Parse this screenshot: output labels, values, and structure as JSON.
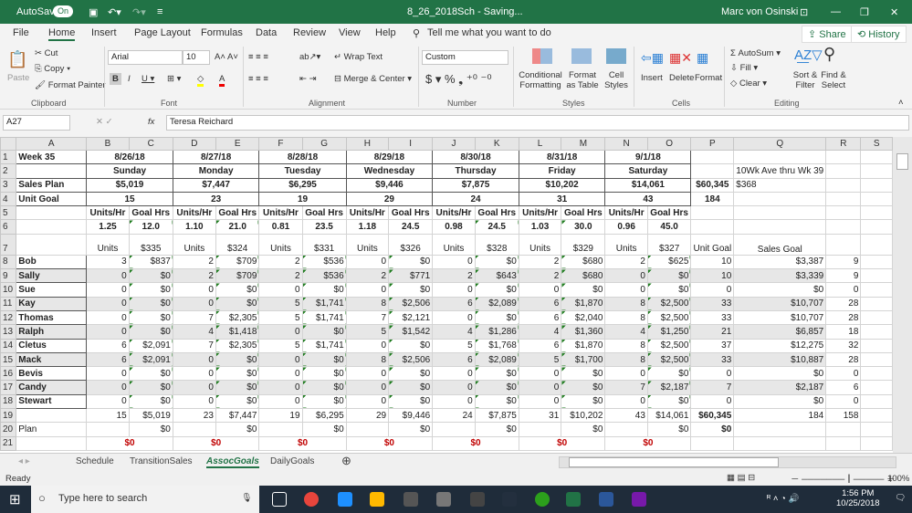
{
  "titlebar": {
    "autosave": "AutoSave",
    "toggle": "On",
    "doc_title": "8_26_2018Sch - Saving...",
    "user": "Marc von Osinski"
  },
  "menu": {
    "tabs": [
      "File",
      "Home",
      "Insert",
      "Page Layout",
      "Formulas",
      "Data",
      "Review",
      "View",
      "Help"
    ],
    "tell_me": "Tell me what you want to do",
    "share": "Share",
    "history": "History"
  },
  "ribbon": {
    "clipboard": {
      "paste": "Paste",
      "cut": "Cut",
      "copy": "Copy",
      "format_painter": "Format Painter",
      "label": "Clipboard"
    },
    "font": {
      "name": "Arial",
      "size": "10",
      "label": "Font"
    },
    "alignment": {
      "wrap": "Wrap Text",
      "merge": "Merge & Center",
      "label": "Alignment"
    },
    "number": {
      "format": "Custom",
      "label": "Number"
    },
    "styles": {
      "conditional": "Conditional Formatting",
      "format_table": "Format as Table",
      "cell_styles": "Cell Styles",
      "label": "Styles"
    },
    "cells": {
      "insert": "Insert",
      "delete": "Delete",
      "format": "Format",
      "label": "Cells"
    },
    "editing": {
      "autosum": "AutoSum",
      "fill": "Fill",
      "clear": "Clear",
      "sort": "Sort & Filter",
      "find": "Find & Select",
      "label": "Editing"
    }
  },
  "formula_bar": {
    "name_box": "A27",
    "fx": "fx",
    "value": "Teresa Reichard"
  },
  "columns": [
    "A",
    "B",
    "C",
    "D",
    "E",
    "F",
    "G",
    "H",
    "I",
    "J",
    "K",
    "L",
    "M",
    "N",
    "O",
    "P",
    "Q",
    "R",
    "S"
  ],
  "rows": [
    [
      "Week 35",
      "8/26/18",
      "",
      "8/27/18",
      "",
      "8/28/18",
      "",
      "8/29/18",
      "",
      "8/30/18",
      "",
      "8/31/18",
      "",
      "9/1/18",
      "",
      "",
      "",
      "",
      ""
    ],
    [
      "",
      "Sunday",
      "",
      "Monday",
      "",
      "Tuesday",
      "",
      "Wednesday",
      "",
      "Thursday",
      "",
      "Friday",
      "",
      "Saturday",
      "",
      "",
      "10Wk Ave thru Wk 39",
      "",
      ""
    ],
    [
      "Sales Plan",
      "$5,019",
      "",
      "$7,447",
      "",
      "$6,295",
      "",
      "$9,446",
      "",
      "$7,875",
      "",
      "$10,202",
      "",
      "$14,061",
      "",
      "$60,345",
      "$368",
      "",
      ""
    ],
    [
      "Unit Goal",
      "15",
      "",
      "23",
      "",
      "19",
      "",
      "29",
      "",
      "24",
      "",
      "31",
      "",
      "43",
      "",
      "184",
      "",
      "",
      ""
    ],
    [
      "",
      "Units/Hr",
      "Goal Hrs",
      "Units/Hr",
      "Goal Hrs",
      "Units/Hr",
      "Goal Hrs",
      "Units/Hr",
      "Goal Hrs",
      "Units/Hr",
      "Goal Hrs",
      "Units/Hr",
      "Goal Hrs",
      "Units/Hr",
      "Goal Hrs",
      "",
      "",
      "",
      ""
    ],
    [
      "",
      "1.25",
      "12.0",
      "1.10",
      "21.0",
      "0.81",
      "23.5",
      "1.18",
      "24.5",
      "0.98",
      "24.5",
      "1.03",
      "30.0",
      "0.96",
      "45.0",
      "",
      "",
      "",
      ""
    ],
    [
      "",
      "Units",
      "$335",
      "Units",
      "$324",
      "Units",
      "$331",
      "Units",
      "$326",
      "Units",
      "$328",
      "Units",
      "$329",
      "Units",
      "$327",
      "Unit Goal",
      "Sales Goal",
      "",
      ""
    ],
    [
      "Bob",
      "3",
      "$837",
      "2",
      "$709",
      "2",
      "$536",
      "0",
      "$0",
      "0",
      "$0",
      "2",
      "$680",
      "2",
      "$625",
      "10",
      "$3,387",
      "9",
      ""
    ],
    [
      "Sally",
      "0",
      "$0",
      "2",
      "$709",
      "2",
      "$536",
      "2",
      "$771",
      "2",
      "$643",
      "2",
      "$680",
      "0",
      "$0",
      "10",
      "$3,339",
      "9",
      ""
    ],
    [
      "Sue",
      "0",
      "$0",
      "0",
      "$0",
      "0",
      "$0",
      "0",
      "$0",
      "0",
      "$0",
      "0",
      "$0",
      "0",
      "$0",
      "0",
      "$0",
      "0",
      ""
    ],
    [
      "Kay",
      "0",
      "$0",
      "0",
      "$0",
      "5",
      "$1,741",
      "8",
      "$2,506",
      "6",
      "$2,089",
      "6",
      "$1,870",
      "8",
      "$2,500",
      "33",
      "$10,707",
      "28",
      ""
    ],
    [
      "Thomas",
      "0",
      "$0",
      "7",
      "$2,305",
      "5",
      "$1,741",
      "7",
      "$2,121",
      "0",
      "$0",
      "6",
      "$2,040",
      "8",
      "$2,500",
      "33",
      "$10,707",
      "28",
      ""
    ],
    [
      "Ralph",
      "0",
      "$0",
      "4",
      "$1,418",
      "0",
      "$0",
      "5",
      "$1,542",
      "4",
      "$1,286",
      "4",
      "$1,360",
      "4",
      "$1,250",
      "21",
      "$6,857",
      "18",
      ""
    ],
    [
      "Cletus",
      "6",
      "$2,091",
      "7",
      "$2,305",
      "5",
      "$1,741",
      "0",
      "$0",
      "5",
      "$1,768",
      "6",
      "$1,870",
      "8",
      "$2,500",
      "37",
      "$12,275",
      "32",
      ""
    ],
    [
      "Mack",
      "6",
      "$2,091",
      "0",
      "$0",
      "0",
      "$0",
      "8",
      "$2,506",
      "6",
      "$2,089",
      "5",
      "$1,700",
      "8",
      "$2,500",
      "33",
      "$10,887",
      "28",
      ""
    ],
    [
      "Bevis",
      "0",
      "$0",
      "0",
      "$0",
      "0",
      "$0",
      "0",
      "$0",
      "0",
      "$0",
      "0",
      "$0",
      "0",
      "$0",
      "0",
      "$0",
      "0",
      ""
    ],
    [
      "Candy",
      "0",
      "$0",
      "0",
      "$0",
      "0",
      "$0",
      "0",
      "$0",
      "0",
      "$0",
      "0",
      "$0",
      "7",
      "$2,187",
      "7",
      "$2,187",
      "6",
      ""
    ],
    [
      "Stewart",
      "0",
      "$0",
      "0",
      "$0",
      "0",
      "$0",
      "0",
      "$0",
      "0",
      "$0",
      "0",
      "$0",
      "0",
      "$0",
      "0",
      "$0",
      "0",
      ""
    ],
    [
      "",
      "15",
      "$5,019",
      "23",
      "$7,447",
      "19",
      "$6,295",
      "29",
      "$9,446",
      "24",
      "$7,875",
      "31",
      "$10,202",
      "43",
      "$14,061",
      "$60,345",
      "184",
      "158",
      ""
    ],
    [
      "Plan",
      "",
      "$0",
      "",
      "$0",
      "",
      "$0",
      "",
      "$0",
      "",
      "$0",
      "",
      "$0",
      "",
      "$0",
      "$0",
      "",
      "",
      ""
    ],
    [
      "",
      "$0",
      "",
      "$0",
      "",
      "$0",
      "",
      "$0",
      "",
      "$0",
      "",
      "$0",
      "",
      "$0",
      "",
      "",
      "",
      "",
      ""
    ]
  ],
  "sheet_tabs": [
    "Schedule",
    "TransitionSales",
    "AssocGoals",
    "DailyGoals"
  ],
  "active_sheet": "AssocGoals",
  "status": {
    "ready": "Ready",
    "zoom": "100%"
  },
  "taskbar": {
    "search": "Type here to search",
    "time": "1:56 PM",
    "date": "10/25/2018"
  },
  "colors": {
    "excel_green": "#217346",
    "red": "#c00000"
  }
}
